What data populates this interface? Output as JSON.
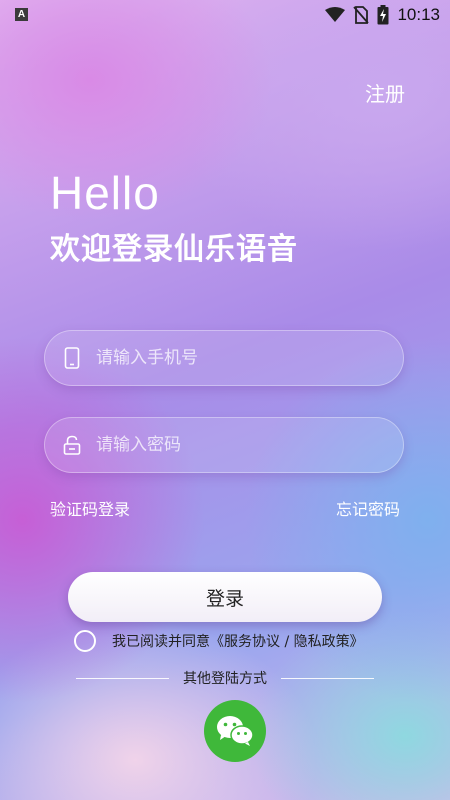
{
  "status_bar": {
    "time": "10:13",
    "left_badge": "A",
    "icons": [
      "wifi-icon",
      "no-sim-icon",
      "battery-charging-icon"
    ]
  },
  "header": {
    "register_label": "注册"
  },
  "greeting": {
    "hello": "Hello",
    "welcome": "欢迎登录仙乐语音"
  },
  "form": {
    "phone_placeholder": "请输入手机号",
    "phone_value": "",
    "password_placeholder": "请输入密码",
    "password_value": "",
    "sms_login_label": "验证码登录",
    "forgot_password_label": "忘记密码",
    "login_button_label": "登录"
  },
  "agreement": {
    "text": "我已阅读并同意",
    "link": "《服务协议 / 隐私政策》",
    "checked": false
  },
  "other_login": {
    "divider_label": "其他登陆方式",
    "icons": [
      "wechat-icon"
    ]
  },
  "colors": {
    "wechat_green": "#3fb83a",
    "login_button_bg": "#ffffff"
  }
}
